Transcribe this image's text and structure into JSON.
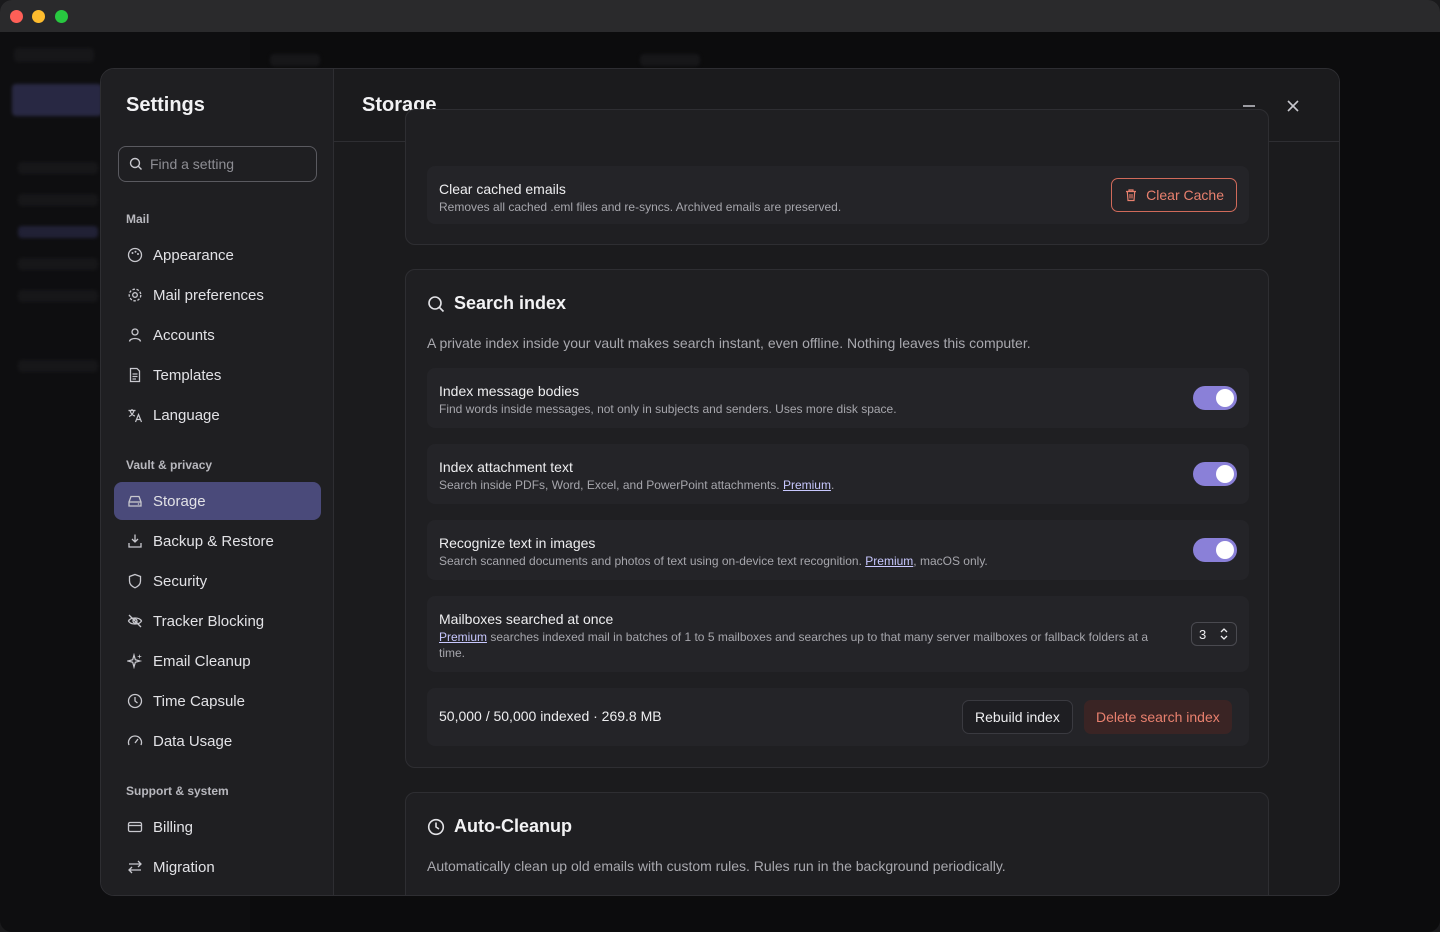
{
  "settings": {
    "title": "Settings",
    "search_placeholder": "Find a setting",
    "groups": {
      "mail": "Mail",
      "vault": "Vault & privacy",
      "support": "Support & system"
    },
    "items": {
      "appearance": "Appearance",
      "mail_preferences": "Mail preferences",
      "accounts": "Accounts",
      "templates": "Templates",
      "language": "Language",
      "storage": "Storage",
      "backup": "Backup & Restore",
      "security": "Security",
      "tracker": "Tracker Blocking",
      "cleanup": "Email Cleanup",
      "capsule": "Time Capsule",
      "data_usage": "Data Usage",
      "billing": "Billing",
      "migration": "Migration"
    },
    "active_item": "Storage"
  },
  "page": {
    "title": "Storage"
  },
  "cache": {
    "title": "Clear cached emails",
    "desc": "Removes all cached .eml files and re-syncs. Archived emails are preserved.",
    "button": "Clear Cache"
  },
  "search_index": {
    "title": "Search index",
    "desc": "A private index inside your vault makes search instant, even offline. Nothing leaves this computer.",
    "premium_link": "Premium",
    "bodies": {
      "title": "Index message bodies",
      "desc": "Find words inside messages, not only in subjects and senders. Uses more disk space.",
      "enabled": true
    },
    "attachments": {
      "title": "Index attachment text",
      "desc": "Search inside PDFs, Word, Excel, and PowerPoint attachments.",
      "enabled": true
    },
    "ocr": {
      "title": "Recognize text in images",
      "desc": "Search scanned documents and photos of text using on-device text recognition.",
      "desc_suffix": ", macOS only.",
      "enabled": true
    },
    "mailboxes": {
      "title": "Mailboxes searched at once",
      "desc": "searches indexed mail in batches of 1 to 5 mailboxes and searches up to that many server mailboxes or fallback folders at a time.",
      "value": "3"
    },
    "status": "50,000 / 50,000 indexed · 269.8 MB",
    "rebuild_button": "Rebuild index",
    "delete_button": "Delete search index"
  },
  "auto_cleanup": {
    "title": "Auto-Cleanup",
    "desc": "Automatically clean up old emails with custom rules. Rules run in the background periodically."
  },
  "colors": {
    "accent": "#8a80d8",
    "active_nav": "#4a4a7a",
    "danger": "#e8806e"
  }
}
